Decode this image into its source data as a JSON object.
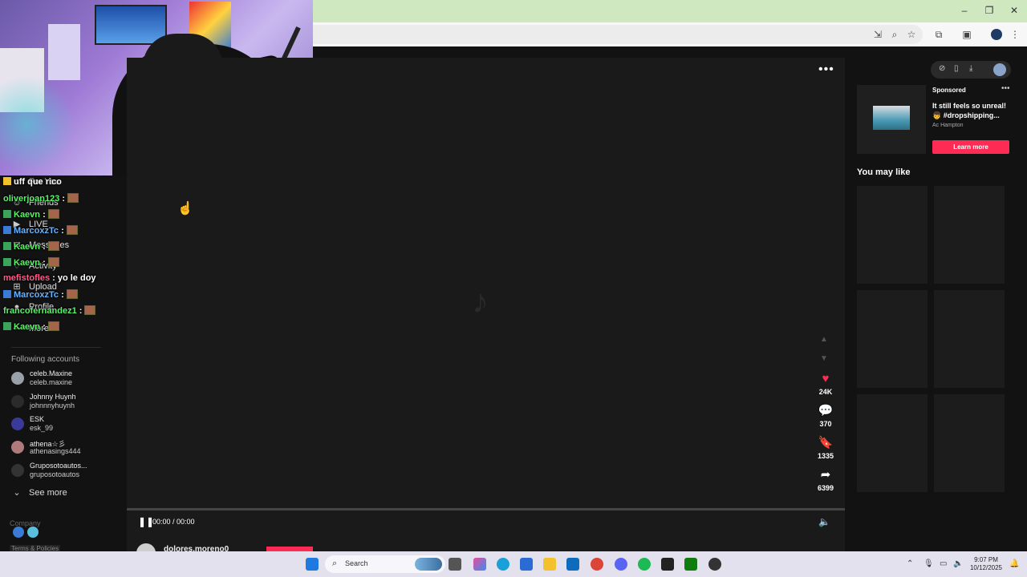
{
  "browser": {
    "window_controls": [
      "–",
      "❐",
      "✕"
    ],
    "toolbar_icons": [
      "install-icon",
      "zoom-icon",
      "star-icon",
      "extensions-icon",
      "sidebar-icon",
      "profile-icon",
      "menu-icon"
    ]
  },
  "left_nav": {
    "items": [
      {
        "label": "For You",
        "icon": "home-icon"
      },
      {
        "label": "Friends",
        "icon": "friends-icon"
      },
      {
        "label": "LIVE",
        "icon": "live-icon"
      },
      {
        "label": "Messages",
        "icon": "messages-icon"
      },
      {
        "label": "Activity",
        "icon": "activity-icon"
      },
      {
        "label": "Upload",
        "icon": "upload-icon"
      },
      {
        "label": "Profile",
        "icon": "profile-icon"
      },
      {
        "label": "More",
        "icon": "more-icon"
      }
    ],
    "following_title": "Following accounts",
    "accounts": [
      {
        "name": "celeb.Maxine",
        "handle": "celeb.maxine",
        "color": "#9aa0a8"
      },
      {
        "name": "Johnny Huynh",
        "handle": "johnnnyhuynh",
        "color": "#2b2b2b"
      },
      {
        "name": "ESK",
        "handle": "esk_99",
        "color": "#3a3a9a"
      },
      {
        "name": "athena☆彡",
        "handle": "athenasings444",
        "color": "#b07a7a"
      },
      {
        "name": "Gruposotoautos...",
        "handle": "gruposotoautos",
        "color": "#333333"
      }
    ],
    "see_more": "See more",
    "company": "Company",
    "terms": "Terms & Policies"
  },
  "chat": [
    {
      "user": "",
      "message": "uff que rico",
      "color": "white",
      "badge": "crown",
      "emote": false
    },
    {
      "user": "oliverjoan123",
      "message": ":",
      "color": "green",
      "badge": "none",
      "emote": true
    },
    {
      "user": "Kaevn",
      "message": ":",
      "color": "green",
      "badge": "sword",
      "emote": true
    },
    {
      "user": "MarcoxzTc",
      "message": ":",
      "color": "blue",
      "badge": "mod",
      "emote": true
    },
    {
      "user": "Kaevn",
      "message": ":",
      "color": "green",
      "badge": "sword",
      "emote": true
    },
    {
      "user": "Kaevn",
      "message": ":",
      "color": "green",
      "badge": "sword",
      "emote": true
    },
    {
      "user": "mefistofles",
      "message": ": yo le doy",
      "color": "pink",
      "badge": "none",
      "emote": false
    },
    {
      "user": "MarcoxzTc",
      "message": ":",
      "color": "blue",
      "badge": "mod",
      "emote": true
    },
    {
      "user": "francofernandez1",
      "message": ":",
      "color": "green",
      "badge": "none",
      "emote": true
    },
    {
      "user": "Kaevn",
      "message": ":",
      "color": "green",
      "badge": "sword",
      "emote": true
    }
  ],
  "video": {
    "logo": "♪",
    "time": "00:00 / 00:00",
    "progress": 0,
    "actions": [
      {
        "name": "like",
        "icon": "♥",
        "count": "24K",
        "color": "#fe2c55"
      },
      {
        "name": "comment",
        "icon": "💬",
        "count": "370",
        "color": "#ffffff"
      },
      {
        "name": "save",
        "icon": "🔖",
        "count": "1335",
        "color": "#ffffff"
      },
      {
        "name": "share",
        "icon": "➦",
        "count": "6399",
        "color": "#ffffff"
      }
    ],
    "creator": "dolores.moreno0"
  },
  "ad": {
    "label": "Sponsored",
    "text": "It still feels so unreal! 👦 #dropshipping...",
    "author": "Ac Hampton",
    "cta": "Learn more"
  },
  "you_may_like": "You may like",
  "taskbar": {
    "search": "Search",
    "time": "9:07 PM",
    "date": "10/12/2025"
  }
}
